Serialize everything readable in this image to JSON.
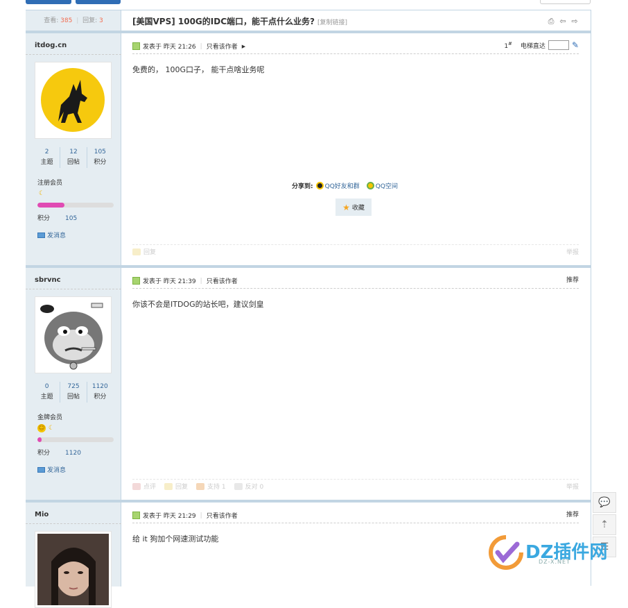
{
  "thread": {
    "views_label": "查看:",
    "views": "385",
    "replies_label": "回复:",
    "replies": "3",
    "title": "[美国VPS] 100G的IDC端口，能干点什么业务?",
    "copy_link": "[复制链接]"
  },
  "posts": [
    {
      "author": "itdog.cn",
      "stats": [
        {
          "value": "2",
          "label": "主题"
        },
        {
          "value": "12",
          "label": "回帖"
        },
        {
          "value": "105",
          "label": "积分"
        }
      ],
      "group": "注册会员",
      "group_progress": 0.35,
      "points_label": "积分",
      "points": "105",
      "pm": "发消息",
      "posted": "发表于 昨天 21:26",
      "only_author": "只看该作者",
      "floor": "1",
      "floor_sup": "#",
      "jump_label": "电梯直达",
      "text": "免费的， 100G口子， 能干点啥业务呢",
      "share_label": "分享到:",
      "share_qq": "QQ好友和群",
      "share_qzone": "QQ空间",
      "favorite": "收藏",
      "reply": "回复",
      "report": "举报"
    },
    {
      "author": "sbrvnc",
      "stats": [
        {
          "value": "0",
          "label": "主题"
        },
        {
          "value": "725",
          "label": "回帖"
        },
        {
          "value": "1120",
          "label": "积分"
        }
      ],
      "group": "金牌会员",
      "group_progress": 0.05,
      "points_label": "积分",
      "points": "1120",
      "pm": "发消息",
      "posted": "发表于 昨天 21:39",
      "only_author": "只看该作者",
      "recommend": "推荐",
      "text": "你该不会是ITDOG的站长吧，建议剑皇",
      "rate": "点评",
      "reply": "回复",
      "support": "支持 1",
      "oppose": "反对 0",
      "report": "举报"
    },
    {
      "author": "Mio",
      "posted": "发表于 昨天 21:29",
      "only_author": "只看该作者",
      "recommend": "推荐",
      "text": "给 it 狗加个网速测试功能"
    }
  ],
  "watermark": {
    "text": "DZ插件网",
    "sub": "DZ-X.NET"
  },
  "colors": {
    "accent": "#2f6db5",
    "sidebar_bg": "#e5edf2",
    "border": "#c2d5e3",
    "link": "#336699",
    "count": "#f26c4f",
    "progress": "#e04bb3"
  }
}
